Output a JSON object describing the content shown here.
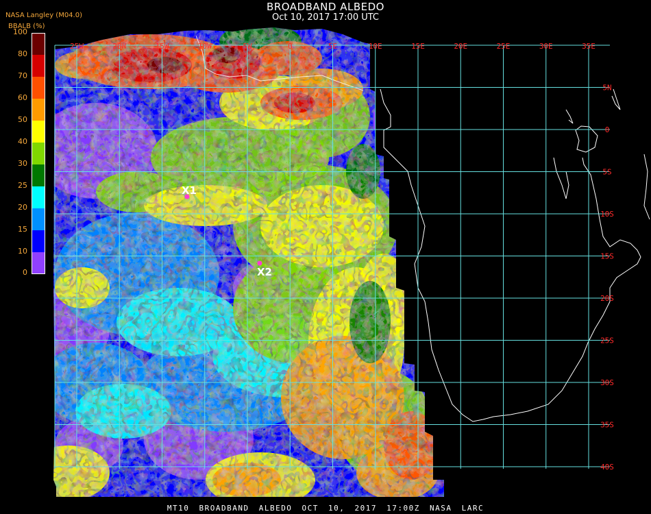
{
  "header": {
    "title": "BROADBAND ALBEDO",
    "subtitle": "Oct 10, 2017 17:00 UTC",
    "producer": "NASA Langley (M04.0)"
  },
  "colorbar": {
    "label": "BBALB (%)",
    "ticks": [
      "100",
      "80",
      "70",
      "60",
      "50",
      "40",
      "30",
      "25",
      "20",
      "15",
      "10",
      "0"
    ],
    "colors": [
      "#6b0000",
      "#d60000",
      "#ff5000",
      "#ff9b00",
      "#ffff00",
      "#80d800",
      "#007800",
      "#00ffff",
      "#0090ff",
      "#0000ff",
      "#9040ff"
    ]
  },
  "map": {
    "lon_labels": [
      "25W",
      "20W",
      "15W",
      "10W",
      "5W",
      "0",
      "5E",
      "10E",
      "15E",
      "20E",
      "25E",
      "30E",
      "35E"
    ],
    "lat_labels": [
      "5N",
      "0",
      "5S",
      "10S",
      "15S",
      "20S",
      "25S",
      "30S",
      "35S",
      "40S"
    ],
    "markers": [
      {
        "label": "X1",
        "color": "#ff3bd4"
      },
      {
        "label": "X2",
        "color": "#ff3bd4"
      }
    ],
    "grid_color": "#66e0e0",
    "label_color": "#ff2a2a",
    "coast_color": "#ffffff"
  },
  "footer": {
    "text": "MT10  BROADBAND ALBEDO   OCT 10, 2017 17:00Z   NASA LARC"
  }
}
